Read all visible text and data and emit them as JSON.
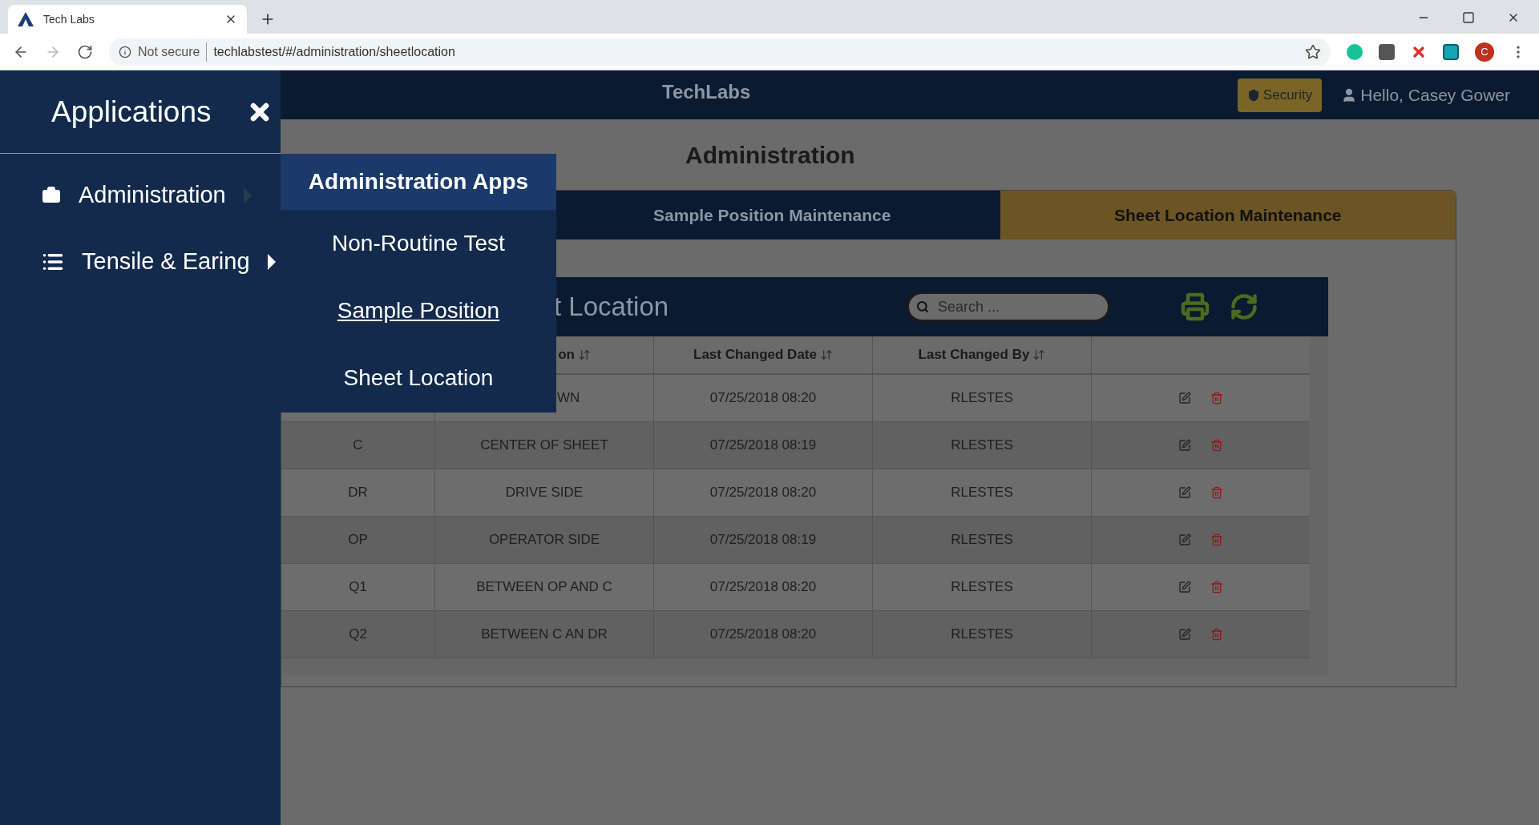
{
  "browser": {
    "tab_title": "Tech Labs",
    "security_label": "Not secure",
    "url": "techlabstest/#/administration/sheetlocation",
    "profile_initial": "C"
  },
  "sidebar": {
    "title": "Applications",
    "items": [
      {
        "label": "Administration",
        "kind": "briefcase",
        "expanded": true
      },
      {
        "label": "Tensile & Earing",
        "kind": "list",
        "expanded": false
      }
    ]
  },
  "submenu": {
    "title": "Administration Apps",
    "items": [
      {
        "label": "Non-Routine Test",
        "hovered": false
      },
      {
        "label": "Sample Position",
        "hovered": true
      },
      {
        "label": "Sheet Location",
        "hovered": false
      }
    ]
  },
  "header": {
    "brand": "TechLabs",
    "security_button": "Security",
    "greeting": "Hello, Casey Gower"
  },
  "page_title": "Administration",
  "tabs": [
    {
      "label": "Sample Position Maintenance",
      "selected": false
    },
    {
      "label": "Sheet Location Maintenance",
      "selected": true
    }
  ],
  "panel": {
    "title": "t Location",
    "search": {
      "placeholder": "Search ..."
    }
  },
  "table": {
    "columns": [
      "on",
      "Last Changed Date",
      "Last Changed By"
    ],
    "rows": [
      {
        "description": "WN",
        "date": "07/25/2018 08:20",
        "by": "RLESTES"
      },
      {
        "code": "C",
        "description": "CENTER OF SHEET",
        "date": "07/25/2018 08:19",
        "by": "RLESTES"
      },
      {
        "code": "DR",
        "description": "DRIVE SIDE",
        "date": "07/25/2018 08:20",
        "by": "RLESTES"
      },
      {
        "code": "OP",
        "description": "OPERATOR SIDE",
        "date": "07/25/2018 08:19",
        "by": "RLESTES"
      },
      {
        "code": "Q1",
        "description": "BETWEEN OP AND C",
        "date": "07/25/2018 08:20",
        "by": "RLESTES"
      },
      {
        "code": "Q2",
        "description": "BETWEEN C AN DR",
        "date": "07/25/2018 08:20",
        "by": "RLESTES"
      }
    ]
  }
}
